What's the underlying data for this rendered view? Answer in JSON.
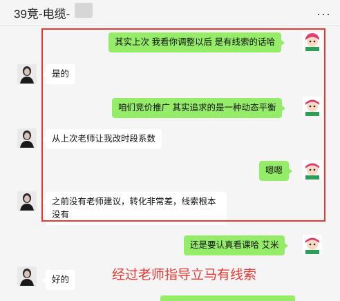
{
  "header": {
    "title": "39竞-电缆-",
    "more_icon": "more-dots-icon"
  },
  "annotation": "经过老师指导立马有线索",
  "messages": [
    {
      "side": "right",
      "text": "其实上次 我看你调整以后 是有线索的话哈"
    },
    {
      "side": "left",
      "text": "是的"
    },
    {
      "side": "right",
      "text": "咱们竞价推广  其实追求的是一种动态平衡"
    },
    {
      "side": "left",
      "text": "从上次老师让我改时段系数"
    },
    {
      "side": "right",
      "text": "嗯嗯"
    },
    {
      "side": "left",
      "text": "之前没有老师建议，转化非常差，线索根本没有"
    },
    {
      "side": "right",
      "text": "还是要认真看课哈   艾米"
    },
    {
      "side": "left",
      "text": "好的"
    }
  ],
  "colors": {
    "sent_bubble": "#95ec69",
    "received_bubble": "#ffffff",
    "highlight": "#e53935"
  },
  "icons": {
    "sender_avatar": "cartoon-girl-avatar-icon",
    "contact_avatar": "person-photo-avatar-icon"
  }
}
